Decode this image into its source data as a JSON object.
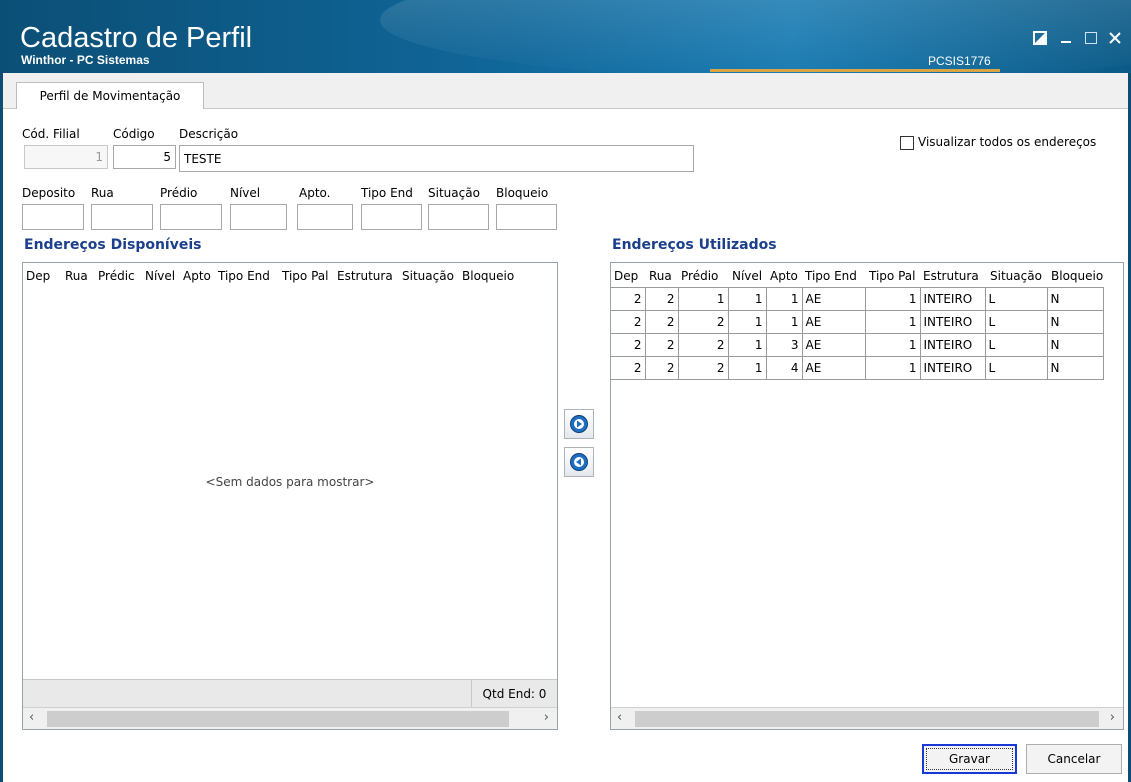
{
  "window": {
    "title": "Cadastro de Perfil",
    "subtitle": "Winthor - PC Sistemas",
    "program_code": "PCSIS1776",
    "colors": {
      "titlebar": "#10679a",
      "accent_line": "#d9a441",
      "section_title": "#1c3f8c"
    }
  },
  "tabs": [
    {
      "label": "Perfil de Movimentação",
      "active": true
    }
  ],
  "form": {
    "cod_filial_label": "Cód. Filial",
    "cod_filial_value": "1",
    "codigo_label": "Código",
    "codigo_value": "5",
    "descricao_label": "Descrição",
    "descricao_value": "TESTE",
    "visualizar_label": "Visualizar todos os endereços",
    "visualizar_checked": false
  },
  "filters": {
    "deposito_label": "Deposito",
    "rua_label": "Rua",
    "predio_label": "Prédio",
    "nivel_label": "Nível",
    "apto_label": "Apto.",
    "tipo_end_label": "Tipo End",
    "situacao_label": "Situação",
    "bloqueio_label": "Bloqueio"
  },
  "available": {
    "title": "Endereços Disponíveis",
    "columns": [
      "Dep",
      "Rua",
      "Prédic",
      "Nível",
      "Apto",
      "Tipo End",
      "Tipo Pal",
      "Estrutura",
      "Situação",
      "Bloqueio"
    ],
    "empty_text": "<Sem dados para mostrar>",
    "footer": "Qtd End: 0"
  },
  "used": {
    "title": "Endereços Utilizados",
    "columns": [
      "Dep",
      "Rua",
      "Prédio",
      "Nível",
      "Apto",
      "Tipo End",
      "Tipo Pal",
      "Estrutura",
      "Situação",
      "Bloqueio"
    ],
    "rows": [
      [
        "2",
        "2",
        "1",
        "1",
        "1",
        "AE",
        "1",
        "INTEIRO",
        "L",
        "N"
      ],
      [
        "2",
        "2",
        "2",
        "1",
        "1",
        "AE",
        "1",
        "INTEIRO",
        "L",
        "N"
      ],
      [
        "2",
        "2",
        "2",
        "1",
        "3",
        "AE",
        "1",
        "INTEIRO",
        "L",
        "N"
      ],
      [
        "2",
        "2",
        "2",
        "1",
        "4",
        "AE",
        "1",
        "INTEIRO",
        "L",
        "N"
      ]
    ]
  },
  "icons": {
    "move_right": "circle-arrow-right-icon",
    "move_left": "circle-arrow-left-icon",
    "scroll_left": "‹",
    "scroll_right": "›"
  },
  "buttons": {
    "gravar": "Gravar",
    "cancelar": "Cancelar"
  }
}
